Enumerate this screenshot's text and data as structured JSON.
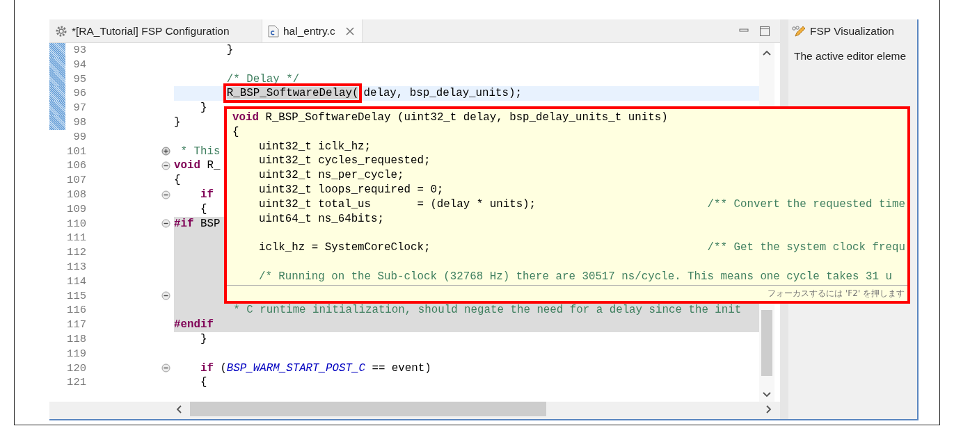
{
  "tabs": [
    {
      "kind": "config",
      "label": "*[RA_Tutorial] FSP Configuration",
      "selected": false,
      "closable": false
    },
    {
      "kind": "source",
      "label": "hal_entry.c",
      "selected": true,
      "closable": true
    }
  ],
  "editor": {
    "lines": [
      {
        "number": "93",
        "changed": true,
        "foldable": false,
        "shaded": false,
        "current": false,
        "code": [
          {
            "kind": "plain",
            "text": "        }"
          }
        ]
      },
      {
        "number": "94",
        "changed": true,
        "foldable": false,
        "shaded": false,
        "current": false
      },
      {
        "number": "95",
        "changed": true,
        "foldable": false,
        "shaded": false,
        "current": false,
        "code": [
          {
            "kind": "comment",
            "text": "        /* Delay */"
          }
        ]
      },
      {
        "number": "96",
        "changed": true,
        "foldable": false,
        "shaded": false,
        "current": true,
        "code": [
          {
            "kind": "selection",
            "text": "        R_BSP_SoftwareDelay("
          },
          {
            "kind": "plain",
            "text": "delay, bsp_delay_units);"
          }
        ]
      },
      {
        "number": "97",
        "changed": true,
        "foldable": false,
        "shaded": false,
        "current": false,
        "code": [
          {
            "kind": "plain",
            "text": "    }"
          }
        ]
      },
      {
        "number": "98",
        "changed": true,
        "foldable": false,
        "shaded": false,
        "current": false,
        "code": [
          {
            "kind": "plain",
            "text": "}"
          }
        ]
      },
      {
        "number": "99",
        "changed": false,
        "foldable": false,
        "shaded": false,
        "current": false
      },
      {
        "number": "101",
        "changed": false,
        "foldable": true,
        "collapsed": true,
        "shaded": false,
        "current": false,
        "code": [
          {
            "kind": "comment",
            "text": " * This"
          }
        ]
      },
      {
        "number": "106",
        "changed": false,
        "foldable": true,
        "collapsed": false,
        "shaded": false,
        "current": false,
        "code": [
          {
            "kind": "keyword",
            "text": "void"
          },
          {
            "kind": "plain",
            "text": " R_"
          }
        ]
      },
      {
        "number": "107",
        "changed": false,
        "foldable": false,
        "shaded": false,
        "current": false,
        "code": [
          {
            "kind": "plain",
            "text": "{"
          }
        ]
      },
      {
        "number": "108",
        "changed": false,
        "foldable": true,
        "collapsed": false,
        "shaded": false,
        "current": false,
        "code": [
          {
            "kind": "keyword",
            "text": "    if"
          }
        ]
      },
      {
        "number": "109",
        "changed": false,
        "foldable": false,
        "shaded": false,
        "current": false,
        "code": [
          {
            "kind": "plain",
            "text": "    {"
          }
        ]
      },
      {
        "number": "110",
        "changed": false,
        "foldable": true,
        "collapsed": false,
        "shaded": true,
        "current": false,
        "code": [
          {
            "kind": "keyword",
            "text": "#if"
          },
          {
            "kind": "plain",
            "text": " BSP"
          }
        ]
      },
      {
        "number": "111",
        "changed": false,
        "foldable": false,
        "shaded": true,
        "current": false
      },
      {
        "number": "112",
        "changed": false,
        "foldable": false,
        "shaded": true,
        "current": false
      },
      {
        "number": "113",
        "changed": false,
        "foldable": false,
        "shaded": true,
        "current": false
      },
      {
        "number": "114",
        "changed": false,
        "foldable": false,
        "shaded": true,
        "current": false
      },
      {
        "number": "115",
        "changed": false,
        "foldable": true,
        "collapsed": false,
        "shaded": true,
        "current": false
      },
      {
        "number": "116",
        "changed": false,
        "foldable": false,
        "shaded": true,
        "current": false,
        "code": [
          {
            "kind": "comment",
            "text": "         * C runtime initialization, should negate the need for a delay since the init"
          }
        ]
      },
      {
        "number": "117",
        "changed": false,
        "foldable": false,
        "shaded": true,
        "current": false,
        "code": [
          {
            "kind": "keyword",
            "text": "#endif"
          }
        ]
      },
      {
        "number": "118",
        "changed": false,
        "foldable": false,
        "shaded": false,
        "current": false,
        "code": [
          {
            "kind": "plain",
            "text": "    }"
          }
        ]
      },
      {
        "number": "119",
        "changed": false,
        "foldable": false,
        "shaded": false,
        "current": false
      },
      {
        "number": "120",
        "changed": false,
        "foldable": true,
        "collapsed": false,
        "shaded": false,
        "current": false,
        "code": [
          {
            "kind": "keyword",
            "text": "    if"
          },
          {
            "kind": "plain",
            "text": " ("
          },
          {
            "kind": "macro",
            "text": "BSP_WARM_START_POST_C"
          },
          {
            "kind": "plain",
            "text": " == event)"
          }
        ]
      },
      {
        "number": "121",
        "changed": false,
        "foldable": false,
        "shaded": false,
        "current": false,
        "code": [
          {
            "kind": "plain",
            "text": "    {"
          }
        ]
      }
    ]
  },
  "hover": {
    "blocks": [
      [
        [
          {
            "kind": "keyword",
            "text": "void"
          },
          {
            "kind": "plain",
            "text": " R_BSP_SoftwareDelay (uint32_t delay, bsp_delay_units_t units)"
          }
        ],
        [
          {
            "kind": "plain",
            "text": "{"
          }
        ],
        [
          {
            "kind": "plain",
            "text": "    uint32_t iclk_hz;"
          }
        ],
        [
          {
            "kind": "plain",
            "text": "    uint32_t cycles_requested;"
          }
        ],
        [
          {
            "kind": "plain",
            "text": "    uint32_t ns_per_cycle;"
          }
        ],
        [
          {
            "kind": "plain",
            "text": "    uint32_t loops_required = 0;"
          }
        ],
        [
          {
            "kind": "plain",
            "text": "    uint32_t total_us       = (delay * units);"
          },
          {
            "kind": "comment",
            "text": "                          /** Convert the requested time"
          }
        ],
        [
          {
            "kind": "plain",
            "text": "    uint64_t ns_64bits;"
          }
        ]
      ],
      [
        [
          {
            "kind": "plain",
            "text": "    iclk_hz = SystemCoreClock;"
          },
          {
            "kind": "comment",
            "text": "                                          /** Get the system clock frequ"
          }
        ]
      ],
      [
        [
          {
            "kind": "comment",
            "text": "    /* Running on the Sub-clock (32768 Hz) there are 30517 ns/cycle. This means one cycle takes 31 u"
          }
        ]
      ]
    ],
    "hint": "フォーカスするには 'F2' を押します"
  },
  "side_panel": {
    "tab": "FSP Visualization",
    "message": "The active editor eleme"
  }
}
